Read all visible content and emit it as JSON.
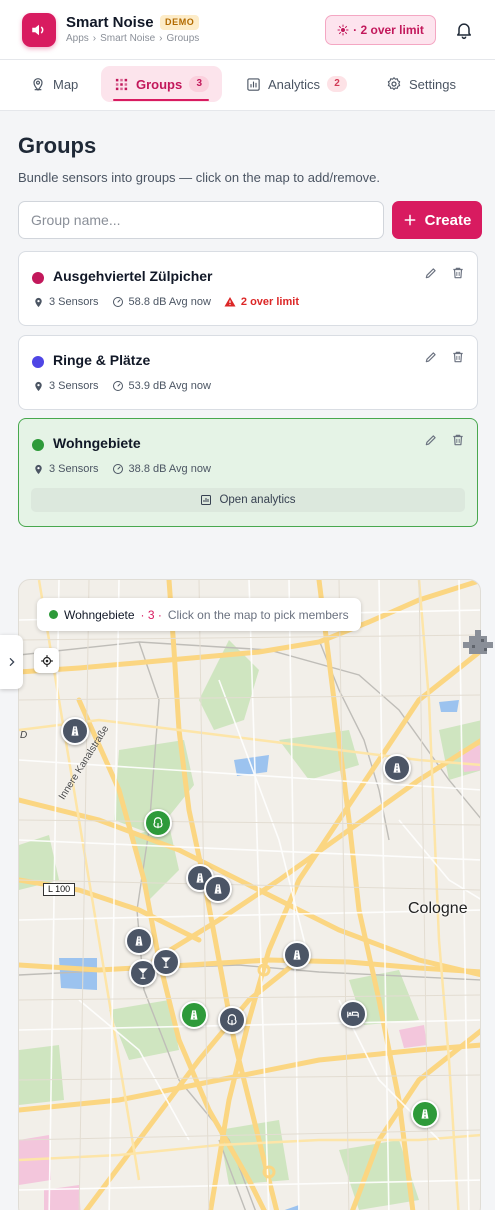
{
  "app": {
    "title": "Smart Noise",
    "badge": "DEMO",
    "breadcrumb": [
      "Apps",
      "›",
      "Smart Noise",
      "›",
      "Groups"
    ],
    "alert_label": "· 2 over limit",
    "accent_color": "#d81b60"
  },
  "tabs": [
    {
      "label": "Map",
      "icon": "map-pin-icon",
      "count": null
    },
    {
      "label": "Groups",
      "icon": "grid-icon",
      "count": "3"
    },
    {
      "label": "Analytics",
      "icon": "bar-chart-icon",
      "count": "2"
    },
    {
      "label": "Settings",
      "icon": "gear-icon",
      "count": null
    }
  ],
  "page": {
    "title": "Groups",
    "subtitle": "Bundle sensors into groups — click on the map to add/remove.",
    "name_placeholder": "Group name...",
    "create_label": "Create"
  },
  "groups": [
    {
      "name": "Ausgehviertel Zülpicher",
      "color": "#c2185b",
      "sensors": "3 Sensors",
      "avg": "58.8 dB Avg now",
      "warning": "2 over limit",
      "selected": false
    },
    {
      "name": "Ringe & Plätze",
      "color": "#4f46e5",
      "sensors": "3 Sensors",
      "avg": "53.9 dB Avg now",
      "warning": null,
      "selected": false
    },
    {
      "name": "Wohngebiete",
      "color": "#2e9a3a",
      "sensors": "3 Sensors",
      "avg": "38.8 dB Avg now",
      "warning": null,
      "selected": true,
      "action": "Open analytics"
    }
  ],
  "map": {
    "chip_group": "Wohngebiete",
    "chip_count": "· 3 ·",
    "chip_hint": "Click on the map to pick members",
    "city_label": "Cologne",
    "road_label": "L 100",
    "street_label": "Innere Kanalstraße",
    "edge_label": "D"
  }
}
